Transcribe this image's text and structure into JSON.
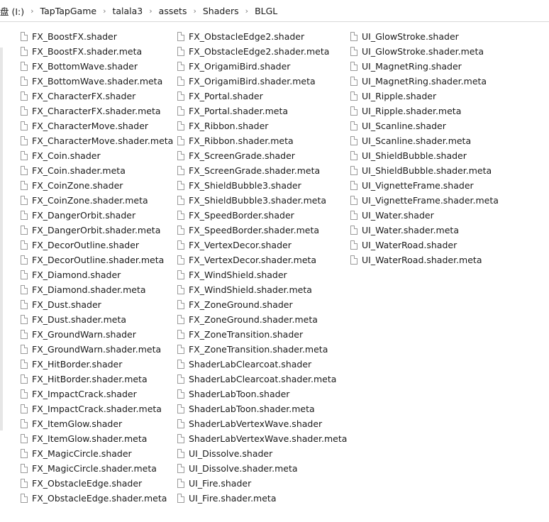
{
  "address_bar": {
    "segments": [
      "盘 (I:)",
      "TapTapGame",
      "talala3",
      "assets",
      "Shaders",
      "BLGL"
    ],
    "separator": "›"
  },
  "file_list": {
    "columns": [
      [
        "FX_BoostFX.shader",
        "FX_BoostFX.shader.meta",
        "FX_BottomWave.shader",
        "FX_BottomWave.shader.meta",
        "FX_CharacterFX.shader",
        "FX_CharacterFX.shader.meta",
        "FX_CharacterMove.shader",
        "FX_CharacterMove.shader.meta",
        "FX_Coin.shader",
        "FX_Coin.shader.meta",
        "FX_CoinZone.shader",
        "FX_CoinZone.shader.meta",
        "FX_DangerOrbit.shader",
        "FX_DangerOrbit.shader.meta",
        "FX_DecorOutline.shader",
        "FX_DecorOutline.shader.meta",
        "FX_Diamond.shader",
        "FX_Diamond.shader.meta",
        "FX_Dust.shader",
        "FX_Dust.shader.meta",
        "FX_GroundWarn.shader",
        "FX_GroundWarn.shader.meta",
        "FX_HitBorder.shader",
        "FX_HitBorder.shader.meta",
        "FX_ImpactCrack.shader",
        "FX_ImpactCrack.shader.meta",
        "FX_ItemGlow.shader",
        "FX_ItemGlow.shader.meta",
        "FX_MagicCircle.shader",
        "FX_MagicCircle.shader.meta",
        "FX_ObstacleEdge.shader",
        "FX_ObstacleEdge.shader.meta"
      ],
      [
        "FX_ObstacleEdge2.shader",
        "FX_ObstacleEdge2.shader.meta",
        "FX_OrigamiBird.shader",
        "FX_OrigamiBird.shader.meta",
        "FX_Portal.shader",
        "FX_Portal.shader.meta",
        "FX_Ribbon.shader",
        "FX_Ribbon.shader.meta",
        "FX_ScreenGrade.shader",
        "FX_ScreenGrade.shader.meta",
        "FX_ShieldBubble3.shader",
        "FX_ShieldBubble3.shader.meta",
        "FX_SpeedBorder.shader",
        "FX_SpeedBorder.shader.meta",
        "FX_VertexDecor.shader",
        "FX_VertexDecor.shader.meta",
        "FX_WindShield.shader",
        "FX_WindShield.shader.meta",
        "FX_ZoneGround.shader",
        "FX_ZoneGround.shader.meta",
        "FX_ZoneTransition.shader",
        "FX_ZoneTransition.shader.meta",
        "ShaderLabClearcoat.shader",
        "ShaderLabClearcoat.shader.meta",
        "ShaderLabToon.shader",
        "ShaderLabToon.shader.meta",
        "ShaderLabVertexWave.shader",
        "ShaderLabVertexWave.shader.meta",
        "UI_Dissolve.shader",
        "UI_Dissolve.shader.meta",
        "UI_Fire.shader",
        "UI_Fire.shader.meta"
      ],
      [
        "UI_GlowStroke.shader",
        "UI_GlowStroke.shader.meta",
        "UI_MagnetRing.shader",
        "UI_MagnetRing.shader.meta",
        "UI_Ripple.shader",
        "UI_Ripple.shader.meta",
        "UI_Scanline.shader",
        "UI_Scanline.shader.meta",
        "UI_ShieldBubble.shader",
        "UI_ShieldBubble.shader.meta",
        "UI_VignetteFrame.shader",
        "UI_VignetteFrame.shader.meta",
        "UI_Water.shader",
        "UI_Water.shader.meta",
        "UI_WaterRoad.shader",
        "UI_WaterRoad.shader.meta"
      ]
    ]
  }
}
